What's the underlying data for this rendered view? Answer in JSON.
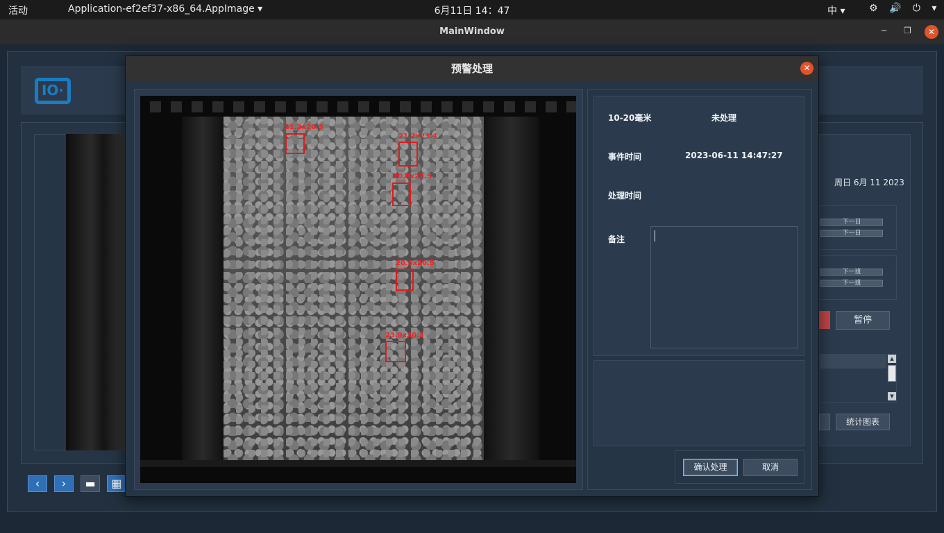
{
  "topbar": {
    "activities": "活动",
    "app_menu": "Application-ef2ef37-x86_64.AppImage ▾",
    "clock": "6月11日  14：47",
    "ime": "中 ▾",
    "tray": "⚙ 🔊 ⏻ ▾"
  },
  "window": {
    "title": "MainWindow",
    "minimize": "─",
    "maximize": "❐",
    "close": "✕"
  },
  "main": {
    "logo_text": "IO·",
    "date_label": "周日 6月 11 2023",
    "next_day_1": "下一日",
    "next_day_2": "下一日",
    "next_shift_1": "下一班",
    "next_shift_2": "下一班",
    "pause_label": "暂停",
    "stats_label": "统计图表",
    "scroll_up": "▲",
    "scroll_down": "▼",
    "nav_prev": "‹",
    "nav_next": "›",
    "nav_single": "▬",
    "nav_grid": "▦"
  },
  "dialog": {
    "title": "预警处理",
    "close": "✕",
    "size_label": "10-20毫米",
    "status_value": "未处理",
    "event_time_label": "事件时间",
    "event_time_value": "2023-06-11 14:47:27",
    "process_time_label": "处理时间",
    "process_time_value": "",
    "remark_label": "备注",
    "remark_value": "",
    "confirm_label": "确认处理",
    "cancel_label": "取消",
    "detections": [
      {
        "label": "21.2x20.3"
      },
      {
        "label": "21.2x23.4"
      },
      {
        "label": "20.0x22.5"
      },
      {
        "label": "20.6x20.5"
      },
      {
        "label": "23.9x20.3"
      }
    ]
  },
  "colors": {
    "accent": "#2f6fb5",
    "close_orange": "#e0532b",
    "detection_red": "#e01b1b",
    "panel_bg": "#2b3b4d"
  }
}
